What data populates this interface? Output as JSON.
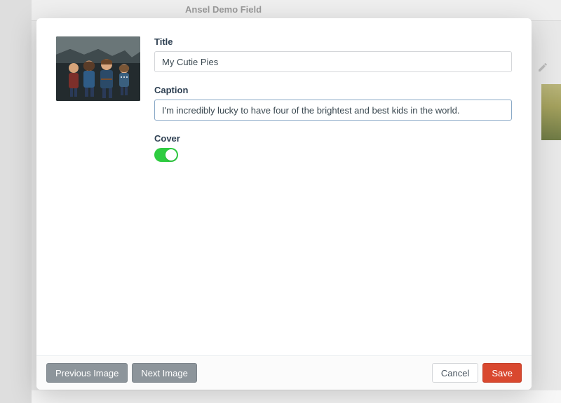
{
  "bg": {
    "section_label": "Ansel Demo Field"
  },
  "fields": {
    "title": {
      "label": "Title",
      "value": "My Cutie Pies"
    },
    "caption": {
      "label": "Caption",
      "value": "I'm incredibly lucky to have four of the brightest and best kids in the world."
    },
    "cover": {
      "label": "Cover",
      "on": true
    }
  },
  "footer": {
    "prev": "Previous Image",
    "next": "Next Image",
    "cancel": "Cancel",
    "save": "Save"
  }
}
